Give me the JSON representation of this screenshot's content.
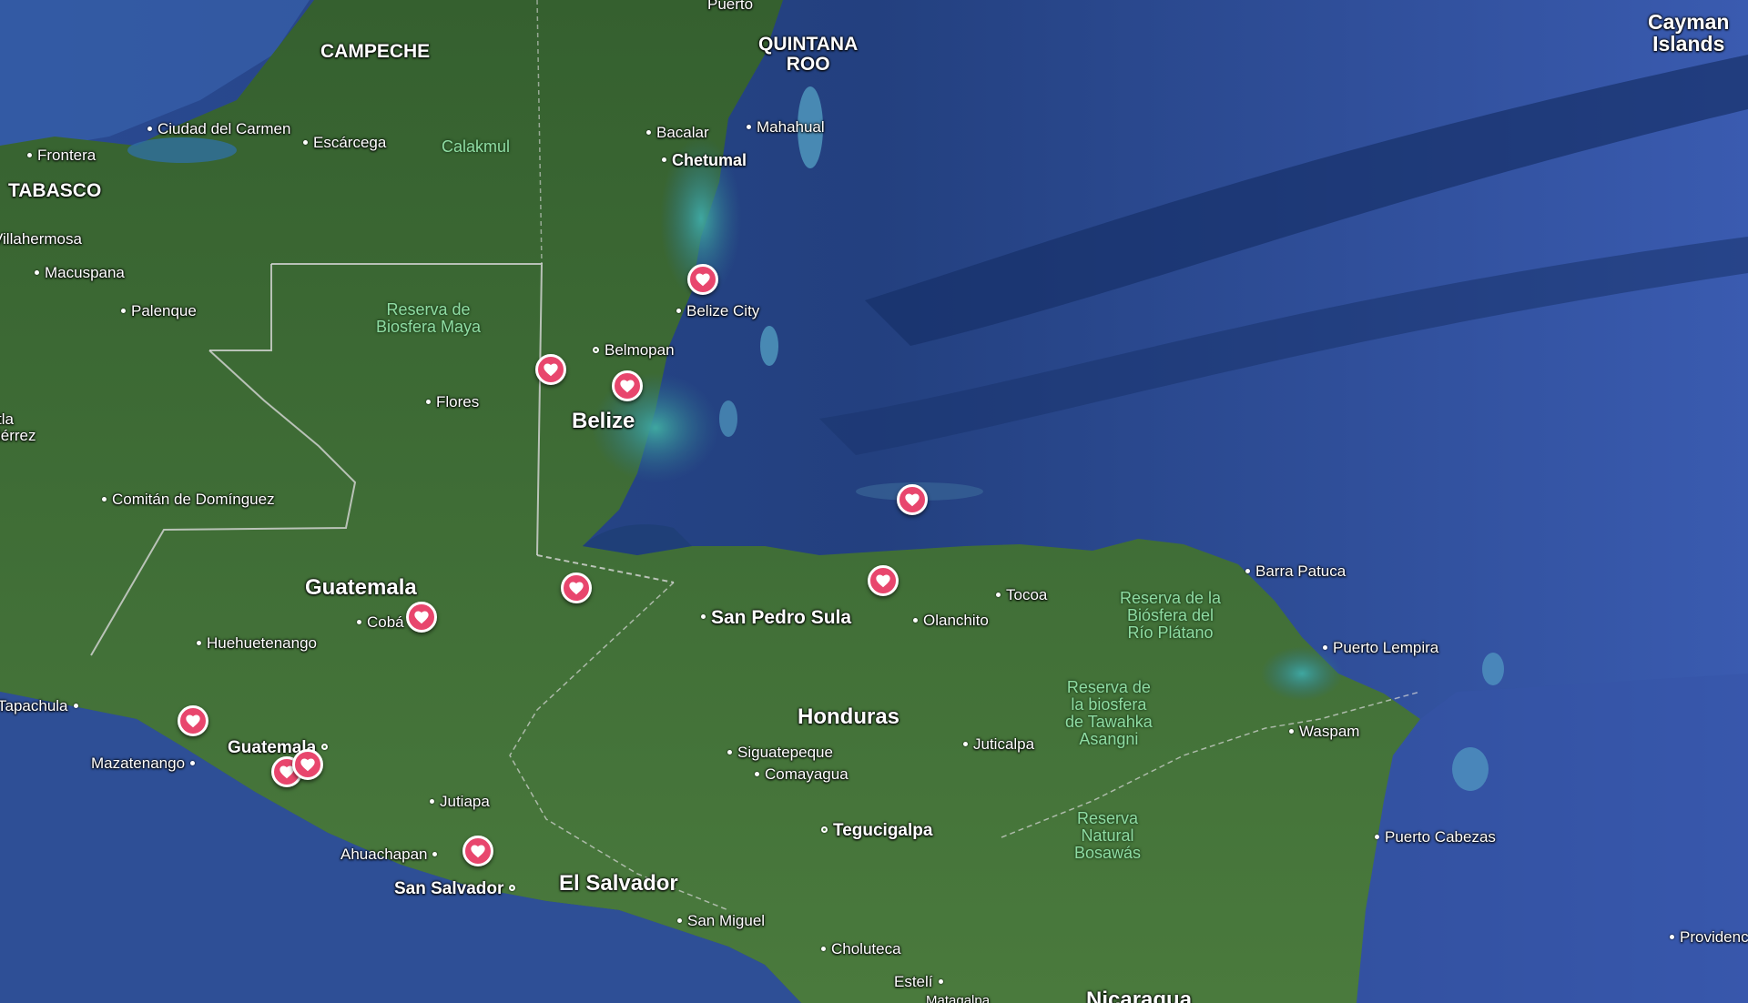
{
  "colors": {
    "ocean": "#2b4a8e",
    "land": "#3d6b3a",
    "pin": "#e8466d",
    "park_label": "#8fdca3"
  },
  "icons": {
    "pin": "heart-marker-icon"
  },
  "labels": {
    "campeche": "CAMPECHE",
    "quintana_roo": "QUINTANA\nROO",
    "puerto": "Puerto",
    "cayman": "Cayman\nIslands",
    "ciudad_carmen": "Ciudad del\nCarmen",
    "frontera": "Frontera",
    "escarcega": "Escárcega",
    "calakmul": "Calakmul",
    "bacalar": "Bacalar",
    "mahahual": "Mahahual",
    "chetumal": "Chetumal",
    "tabasco": "TABASCO",
    "villahermosa": "Villahermosa",
    "macuspana": "Macuspana",
    "palenque": "Palenque",
    "maya": "Reserva de\nBiosfera Maya",
    "belize_city": "Belize City",
    "belmopan": "Belmopan",
    "belize": "Belize",
    "flores": "Flores",
    "tla": "tla\niérrez",
    "comitan": "Comitán de\nDomínguez",
    "barra_patuca": "Barra Patuca",
    "guatemala_country": "Guatemala",
    "coban": "Cobá",
    "san_pedro_sula": "San Pedro Sula",
    "olanchito": "Olanchito",
    "tocoa": "Tocoa",
    "rio_platano": "Reserva de la\nBiósfera del\nRío Plátano",
    "huehuetenango": "Huehuetenango",
    "puerto_lempira": "Puerto\nLempira",
    "tapachula": "Tapachula",
    "honduras": "Honduras",
    "tawahka": "Reserva de\nla biosfera\nde Tawahka\nAsangni",
    "waspam": "Waspam",
    "guatemala_city": "Guatemala",
    "juticalpa": "Juticalpa",
    "mazatenango": "Mazatenango",
    "siguatepeque": "Siguatepeque",
    "comayagua": "Comayagua",
    "jutiapa": "Jutiapa",
    "bosawas": "Reserva\nNatural\nBosawás",
    "tegucigalpa": "Tegucigalpa",
    "puerto_cabezas": "Puerto Cabezas",
    "ahuachapan": "Ahuachapan",
    "san_salvador": "San Salvador",
    "el_salvador": "El Salvador",
    "san_miguel": "San Miguel",
    "providencia": "Providenc",
    "choluteca": "Choluteca",
    "esteli": "Estelí",
    "nicaragua": "Nicaragua",
    "matagalpa": "Matagalpa"
  },
  "pins": [
    {
      "id": "belize-city"
    },
    {
      "id": "belize-west"
    },
    {
      "id": "belmopan-south"
    },
    {
      "id": "roatan"
    },
    {
      "id": "la-ceiba"
    },
    {
      "id": "rio-dulce"
    },
    {
      "id": "coban"
    },
    {
      "id": "quetzaltenango"
    },
    {
      "id": "antigua-1"
    },
    {
      "id": "antigua-2"
    },
    {
      "id": "el-salvador-west"
    }
  ]
}
